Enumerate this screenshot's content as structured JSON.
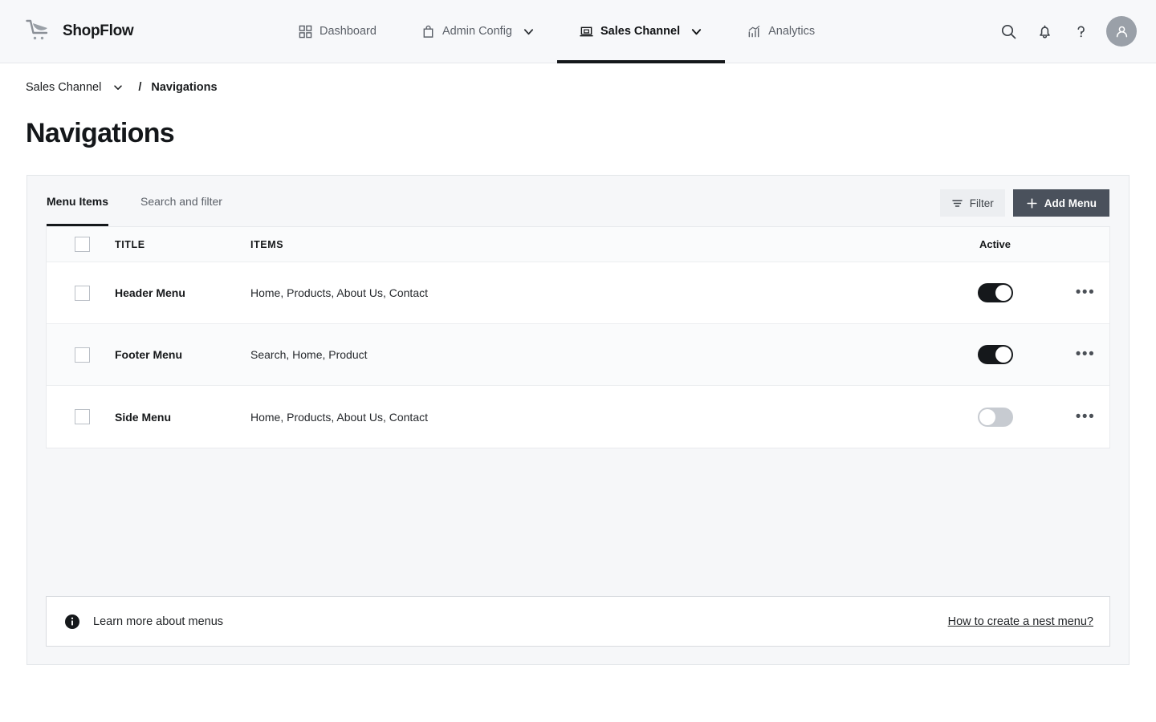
{
  "brand": {
    "name": "ShopFlow",
    "logo_icon": "shopping-cart-icon"
  },
  "topnav": {
    "items": [
      {
        "label": "Dashboard",
        "icon": "grid-icon",
        "active": false,
        "has_caret": false
      },
      {
        "label": "Admin Config",
        "icon": "bag-icon",
        "active": false,
        "has_caret": true
      },
      {
        "label": "Sales Channel",
        "icon": "storefront-icon",
        "active": true,
        "has_caret": true
      },
      {
        "label": "Analytics",
        "icon": "chart-up-icon",
        "active": false,
        "has_caret": false
      }
    ],
    "actions": [
      {
        "name": "search-icon"
      },
      {
        "name": "notification-bell-icon"
      },
      {
        "name": "help-question-icon"
      }
    ],
    "avatar_icon": "user-avatar-icon"
  },
  "breadcrumb": {
    "root": "Sales Channel",
    "caret_icon": "chevron-down-icon",
    "separator": "/",
    "current": "Navigations"
  },
  "page": {
    "title": "Navigations"
  },
  "card": {
    "tabs": [
      {
        "label": "Menu Items",
        "active": true
      },
      {
        "label": "Search and filter",
        "active": false
      }
    ],
    "filter_button": {
      "label": "Filter",
      "icon": "filter-icon"
    },
    "add_button": {
      "label": "Add Menu",
      "icon": "plus-icon"
    }
  },
  "table": {
    "columns": {
      "title": "TITLE",
      "items": "ITEMS",
      "active": "Active"
    },
    "rows": [
      {
        "title": "Header Menu",
        "items": "Home, Products, About Us, Contact",
        "active": true,
        "checked": false
      },
      {
        "title": "Footer Menu",
        "items": "Search, Home, Product",
        "active": true,
        "checked": false
      },
      {
        "title": "Side Menu",
        "items": "Home, Products, About Us, Contact",
        "active": false,
        "checked": false
      }
    ],
    "row_menu_icon": "ellipsis-horizontal-icon"
  },
  "info_bar": {
    "icon": "info-circle-icon",
    "text": "Learn more about menus",
    "link": "How to create a nest menu?"
  },
  "colors": {
    "accent_dark": "#15181b",
    "add_button_bg": "#4a515c",
    "page_bg": "#ffffff",
    "card_bg": "#f6f7f9",
    "toggle_on": "#15181b",
    "toggle_off": "#c7cbd1"
  }
}
